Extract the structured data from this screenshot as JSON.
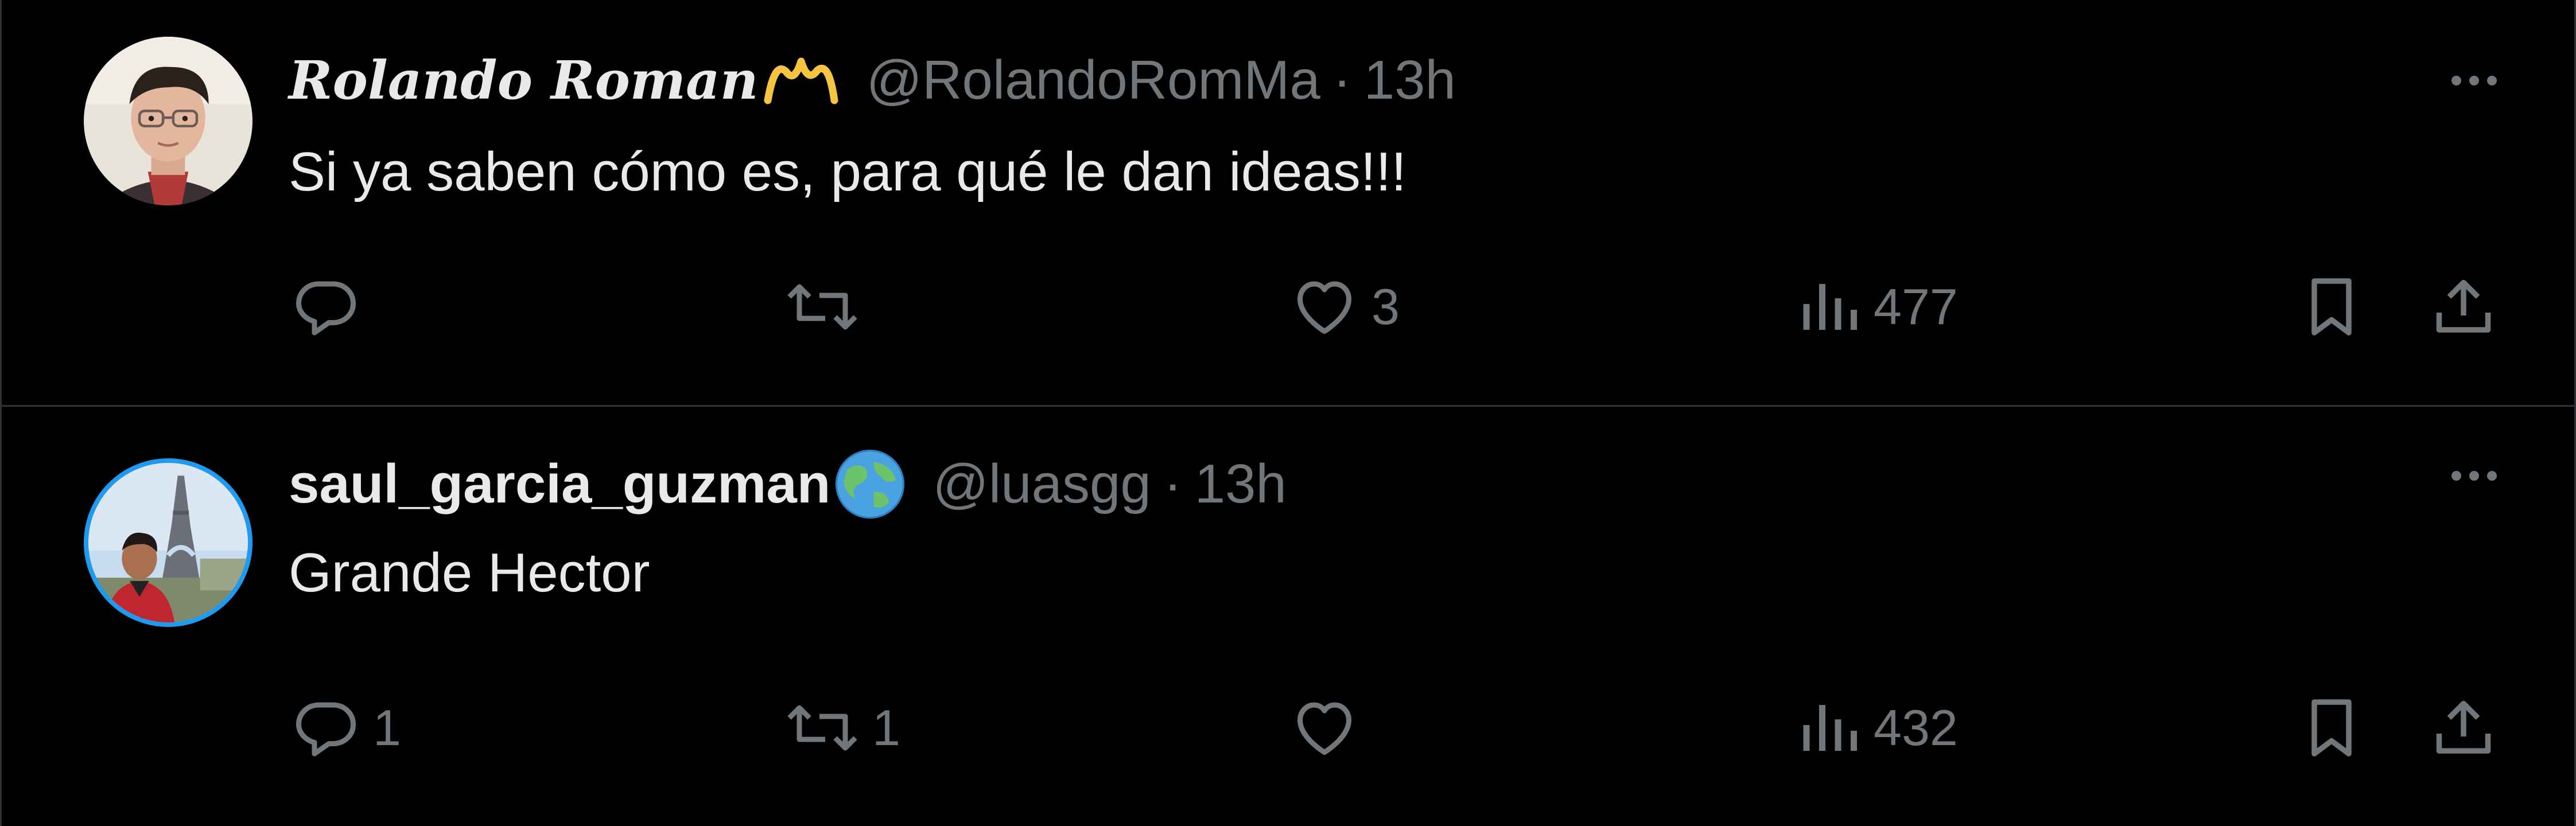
{
  "replies": [
    {
      "author_name": "Rolando Roman",
      "handle": "@RolandoRomMa",
      "separator": "·",
      "time": "13h",
      "text": "Si ya saben cómo es, para qué le dan ideas!!!",
      "name_badge": "yellow-m-emblem",
      "reply_count": "",
      "retweet_count": "",
      "like_count": "3",
      "view_count": "477"
    },
    {
      "author_name": "saul_garcia_guzman",
      "handle": "@luasgg",
      "separator": "·",
      "time": "13h",
      "text": "Grande Hector",
      "name_badge": "globe-emoji",
      "reply_count": "1",
      "retweet_count": "1",
      "like_count": "",
      "view_count": "432"
    }
  ],
  "icons": {
    "reply": "reply-icon",
    "retweet": "retweet-icon",
    "like": "heart-icon",
    "views": "views-chart-icon",
    "bookmark": "bookmark-icon",
    "share": "share-icon",
    "more": "more-options-icon"
  },
  "colors": {
    "background": "#000000",
    "text_primary": "#e7e9ea",
    "text_secondary": "#71767b",
    "divider": "#2f3336",
    "avatar_ring": "#1d9bf0",
    "badge_yellow": "#f5c542"
  }
}
